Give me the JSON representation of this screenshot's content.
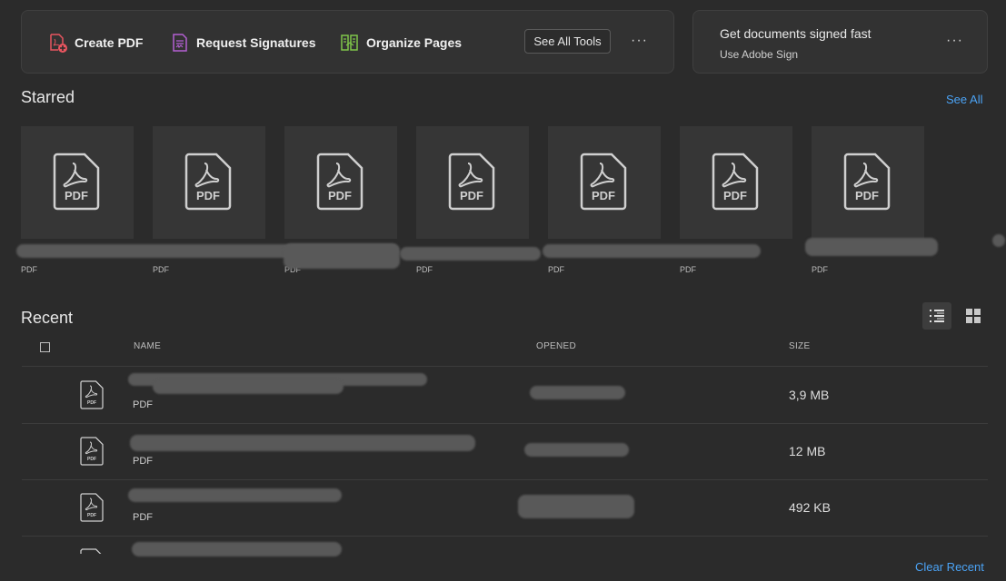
{
  "toolbar": {
    "create_pdf": "Create PDF",
    "request_signatures": "Request Signatures",
    "organize_pages": "Organize Pages",
    "see_all_tools": "See All Tools",
    "more": "···"
  },
  "sign_promo": {
    "title": "Get documents signed fast",
    "subtitle": "Use Adobe Sign",
    "more": "···"
  },
  "starred": {
    "title": "Starred",
    "see_all": "See All",
    "items": [
      {
        "type": "PDF",
        "thumb_label": "PDF"
      },
      {
        "type": "PDF",
        "thumb_label": "PDF"
      },
      {
        "type": "PDF",
        "thumb_label": "PDF"
      },
      {
        "type": "PDF",
        "thumb_label": "PDF"
      },
      {
        "type": "PDF",
        "thumb_label": "PDF"
      },
      {
        "type": "PDF",
        "thumb_label": "PDF"
      },
      {
        "type": "PDF",
        "thumb_label": "PDF"
      }
    ]
  },
  "recent": {
    "title": "Recent",
    "columns": {
      "name": "NAME",
      "opened": "OPENED",
      "size": "SIZE"
    },
    "rows": [
      {
        "type": "PDF",
        "size": "3,9 MB",
        "icon_label": "PDF"
      },
      {
        "type": "PDF",
        "size": "12 MB",
        "icon_label": "PDF"
      },
      {
        "type": "PDF",
        "size": "492 KB",
        "icon_label": "PDF"
      }
    ],
    "clear_recent": "Clear Recent"
  },
  "colors": {
    "background": "#2b2b2b",
    "panel": "#323232",
    "link": "#4ba3f5",
    "create_pdf_icon": "#e8555f",
    "request_sig_icon": "#b35fd2",
    "organize_icon": "#7fc64a"
  }
}
